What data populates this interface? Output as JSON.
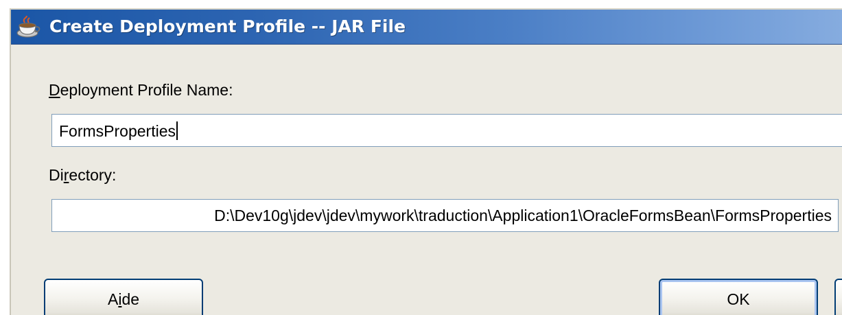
{
  "window": {
    "title": "Create Deployment Profile -- JAR File",
    "title_icon": "java-coffee-cup-icon"
  },
  "form": {
    "profile_name_label_mnemonic": "D",
    "profile_name_label_rest": "eployment Profile Name:",
    "profile_name_value": "FormsProperties",
    "directory_label_start": "Di",
    "directory_label_mnemonic": "r",
    "directory_label_rest": "ectory:",
    "directory_value": "D:\\Dev10g\\jdev\\jdev\\mywork\\traduction\\Application1\\OracleFormsBean\\FormsProperties"
  },
  "buttons": {
    "help_label_start": "A",
    "help_label_mnemonic": "i",
    "help_label_rest": "de",
    "ok_label": "OK"
  },
  "colors": {
    "titlebar_start": "#1b56a6",
    "titlebar_end": "#86acdf",
    "dialog_background": "#eceae2",
    "field_border": "#7f9db9",
    "button_border": "#003c74"
  }
}
